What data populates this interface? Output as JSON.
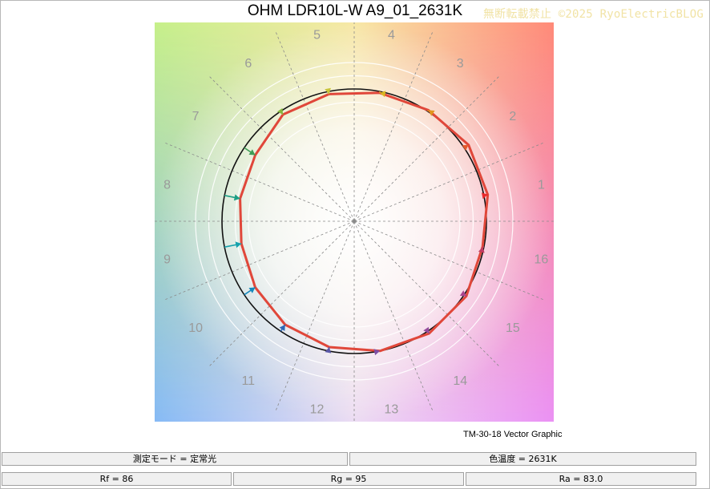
{
  "title": "OHM LDR10L-W A9_01_2631K",
  "watermark": "無断転載禁止  ©2025 RyoElectricBLOG",
  "caption": "TM-30-18 Vector Graphic",
  "status": {
    "mode": "測定モード = 定常光",
    "cct": "色温度 = 2631K",
    "rf": "Rf = 86",
    "rg": "Rg = 95",
    "ra": "Ra = 83.0"
  },
  "chart_data": {
    "type": "vector-graphic",
    "hue_bins": [
      "1",
      "2",
      "3",
      "4",
      "5",
      "6",
      "7",
      "8",
      "9",
      "10",
      "11",
      "12",
      "13",
      "14",
      "15",
      "16"
    ],
    "reference_radius": 1.0,
    "test_points": [
      {
        "bin": "1",
        "r": 1.03
      },
      {
        "bin": "2",
        "r": 1.04
      },
      {
        "bin": "3",
        "r": 1.01
      },
      {
        "bin": "4",
        "r": 0.99
      },
      {
        "bin": "5",
        "r": 0.98
      },
      {
        "bin": "6",
        "r": 0.97
      },
      {
        "bin": "7",
        "r": 0.9
      },
      {
        "bin": "8",
        "r": 0.88
      },
      {
        "bin": "9",
        "r": 0.87
      },
      {
        "bin": "10",
        "r": 0.9
      },
      {
        "bin": "11",
        "r": 0.94
      },
      {
        "bin": "12",
        "r": 0.97
      },
      {
        "bin": "13",
        "r": 1.0
      },
      {
        "bin": "14",
        "r": 1.02
      },
      {
        "bin": "15",
        "r": 1.02
      },
      {
        "bin": "16",
        "r": 0.99
      }
    ],
    "arrow_colors": [
      "#e8292b",
      "#e55a2c",
      "#e0941d",
      "#d9b722",
      "#c8c53a",
      "#84b63e",
      "#3f9e57",
      "#1d9f85",
      "#16a2ad",
      "#1489bd",
      "#2d67b6",
      "#5a58a8",
      "#7e4ea5",
      "#934c9c",
      "#a9468e",
      "#c03c62"
    ],
    "polygon_color": "#e0473a",
    "reference_circle_color": "#111111"
  }
}
